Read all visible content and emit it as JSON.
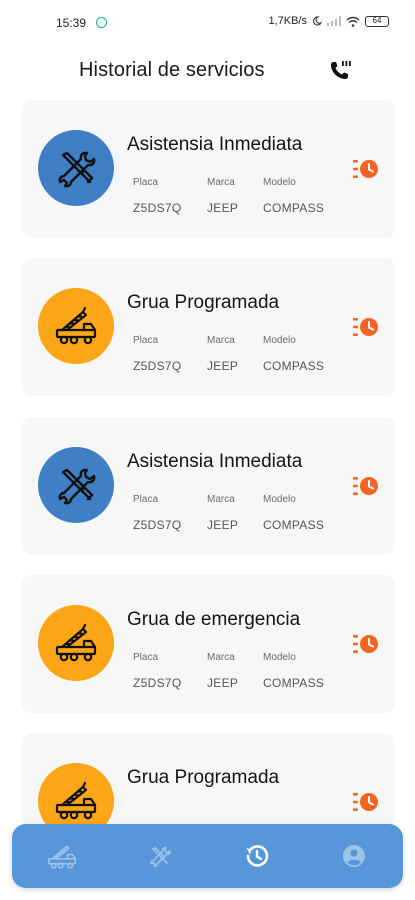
{
  "status_bar": {
    "time": "15:39",
    "network_speed": "1,7KB/s",
    "battery": "64"
  },
  "header": {
    "title": "Historial de servicios"
  },
  "labels": {
    "placa": "Placa",
    "marca": "Marca",
    "modelo": "Modelo"
  },
  "services": [
    {
      "title": "Asistensia Inmediata",
      "type": "assistance",
      "icon": "tools-icon",
      "color": "#3f7fc6",
      "placa": "Z5DS7Q",
      "marca": "JEEP",
      "modelo": "COMPASS"
    },
    {
      "title": "Grua Programada",
      "type": "tow",
      "icon": "crane-truck-icon",
      "color": "#fba517",
      "placa": "Z5DS7Q",
      "marca": "JEEP",
      "modelo": "COMPASS"
    },
    {
      "title": "Asistensia Inmediata",
      "type": "assistance",
      "icon": "tools-icon",
      "color": "#3f7fc6",
      "placa": "Z5DS7Q",
      "marca": "JEEP",
      "modelo": "COMPASS"
    },
    {
      "title": "Grua de emergencia",
      "type": "tow",
      "icon": "crane-truck-icon",
      "color": "#fba517",
      "placa": "Z5DS7Q",
      "marca": "JEEP",
      "modelo": "COMPASS"
    },
    {
      "title": "Grua Programada",
      "type": "tow",
      "icon": "crane-truck-icon",
      "color": "#fba517",
      "placa": "",
      "marca": "",
      "modelo": ""
    }
  ],
  "bottom_nav": {
    "items": [
      {
        "icon": "crane-truck-icon",
        "active": false
      },
      {
        "icon": "tools-icon",
        "active": false
      },
      {
        "icon": "history-icon",
        "active": true
      },
      {
        "icon": "account-icon",
        "active": false
      }
    ]
  },
  "colors": {
    "accent_orange": "#f26522",
    "nav_background": "#5796d8",
    "assistance_blue": "#3f7fc6",
    "tow_orange": "#fba517"
  }
}
